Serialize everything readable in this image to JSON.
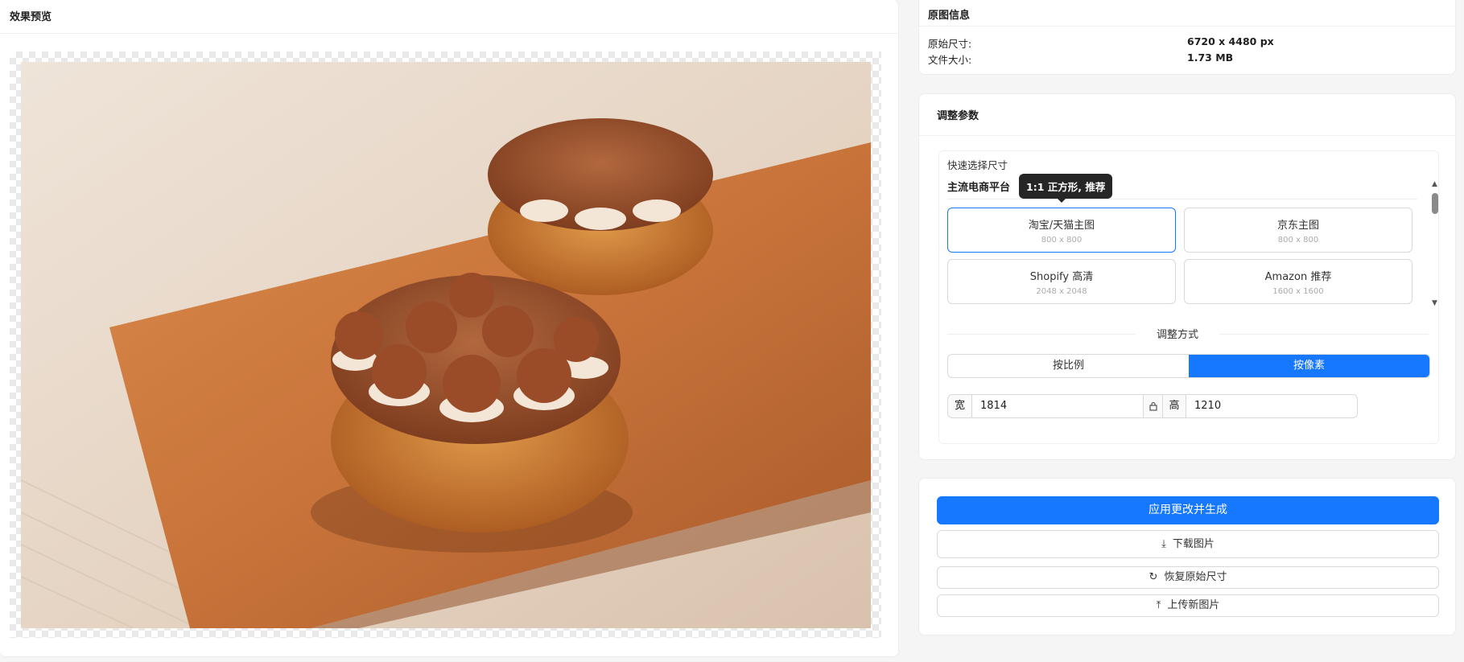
{
  "preview": {
    "title": "效果预览"
  },
  "original_info": {
    "title": "原图信息",
    "rows": [
      {
        "label": "原始尺寸:",
        "value": "6720 x 4480 px"
      },
      {
        "label": "文件大小:",
        "value": "1.73 MB"
      }
    ]
  },
  "adjust": {
    "title": "调整参数",
    "quick_label": "快速选择尺寸",
    "platform_label": "主流电商平台",
    "tooltip": "1:1 正方形, 推荐",
    "presets": [
      {
        "name": "淘宝/天猫主图",
        "size": "800 x 800",
        "active": true
      },
      {
        "name": "京东主图",
        "size": "800 x 800",
        "active": false
      },
      {
        "name": "Shopify 高清",
        "size": "2048 x 2048",
        "active": false
      },
      {
        "name": "Amazon 推荐",
        "size": "1600 x 1600",
        "active": false
      }
    ],
    "mode_label": "调整方式",
    "modes": [
      "按比例",
      "按像素"
    ],
    "active_mode": "按像素",
    "width_label": "宽",
    "width_value": "1814",
    "height_label": "高",
    "height_value": "1210"
  },
  "actions": {
    "apply": "应用更改并生成",
    "download": "下载图片",
    "reset": "恢复原始尺寸",
    "upload": "上传新图片"
  },
  "colors": {
    "primary": "#1677ff"
  }
}
